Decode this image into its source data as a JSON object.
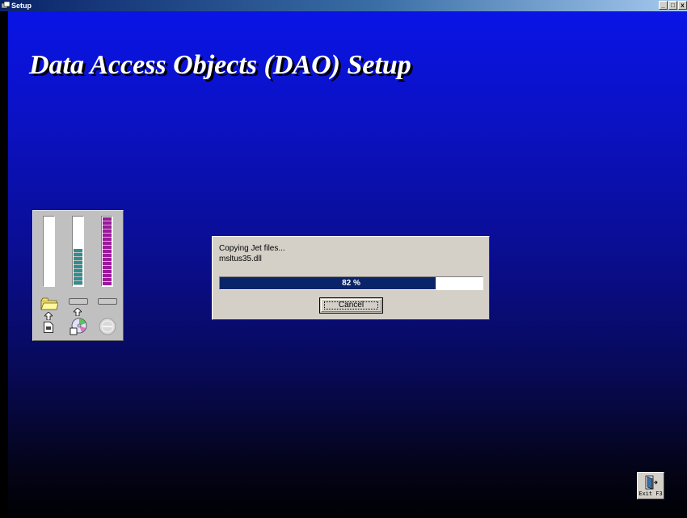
{
  "window": {
    "title": "Setup",
    "minimize_label": "_",
    "maximize_label": "□",
    "close_label": "x"
  },
  "setup_title": "Data Access Objects (DAO) Setup",
  "meters": {
    "destination_disk_fill": 0,
    "source_disk_fill": 0.55,
    "memory_fill": 1.0,
    "icons": [
      "folder-icon",
      "arrow-up-icon",
      "document-icon",
      "cd-icon",
      "memory-icon"
    ]
  },
  "dialog": {
    "status": "Copying Jet files...",
    "filename": "msltus35.dll",
    "progress_percent": 82,
    "progress_text": "82 %",
    "cancel_label": "Cancel"
  },
  "exit": {
    "label": "Exit F3",
    "icon": "exit-door-icon"
  },
  "colors": {
    "progress_bar": "#0a246a",
    "meter_source": "#2f8f8f",
    "meter_memory": "#9a1a9a",
    "background_top": "#0a14e6",
    "background_bottom": "#000004"
  }
}
